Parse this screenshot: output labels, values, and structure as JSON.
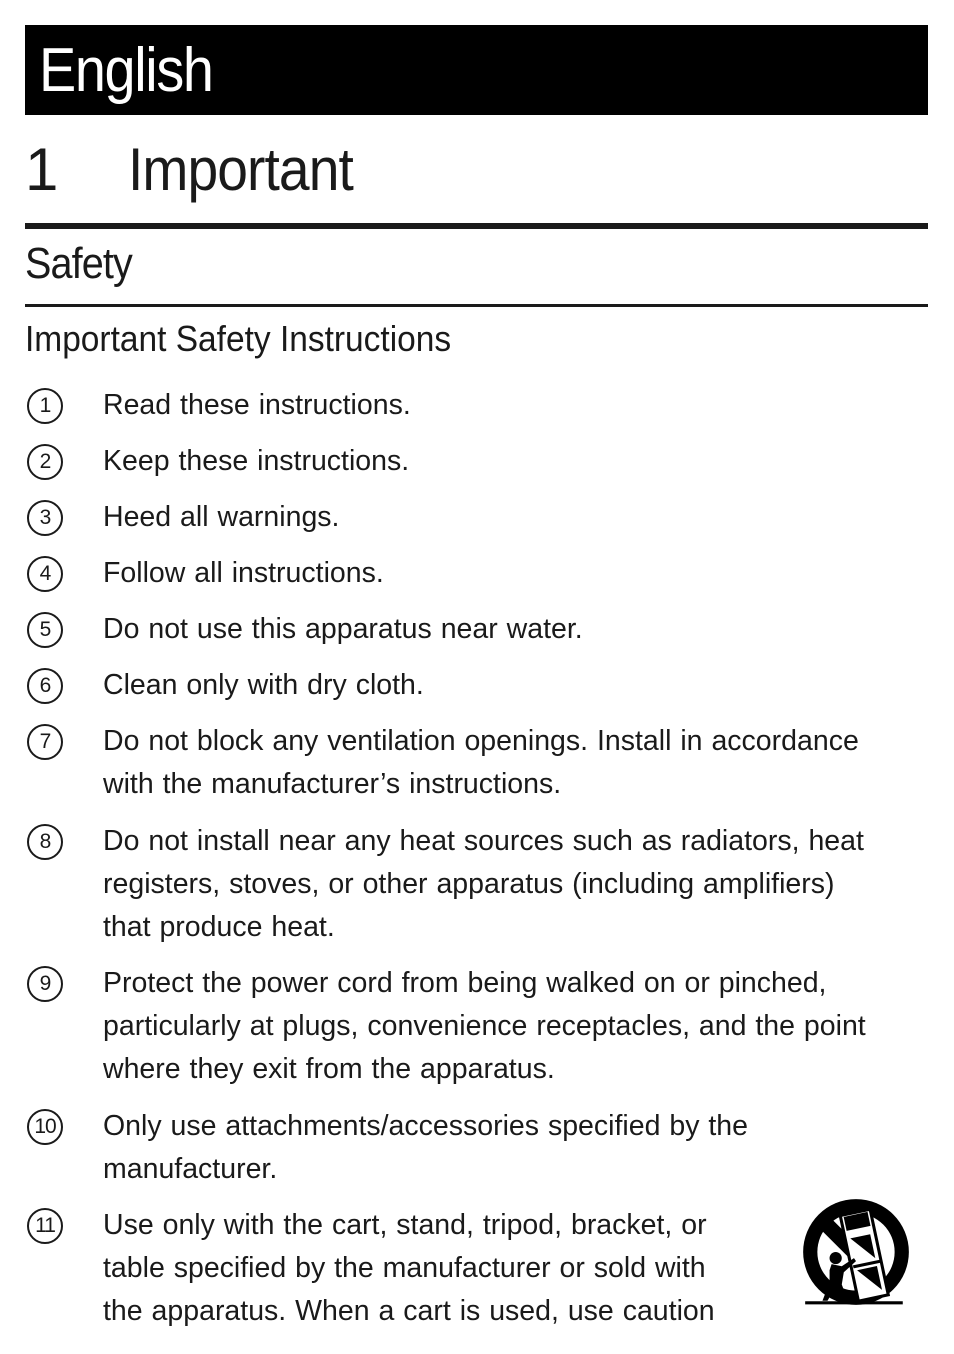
{
  "header": {
    "language": "English",
    "chapter_number": "1",
    "chapter_title": "Important",
    "section_title": "Safety",
    "subsection_title": "Important Safety Instructions"
  },
  "instructions": [
    {
      "number": "1",
      "text": "Read these instructions."
    },
    {
      "number": "2",
      "text": "Keep these instructions."
    },
    {
      "number": "3",
      "text": "Heed all warnings."
    },
    {
      "number": "4",
      "text": "Follow all instructions."
    },
    {
      "number": "5",
      "text": "Do not use this apparatus near water."
    },
    {
      "number": "6",
      "text": "Clean only with dry cloth."
    },
    {
      "number": "7",
      "text": "Do not block any ventilation openings. Install in accordance\nwith the manufacturer’s instructions."
    },
    {
      "number": "8",
      "text": "Do not install near any heat sources such as radiators, heat\nregisters, stoves, or other apparatus (including amplifiers)\nthat produce heat."
    },
    {
      "number": "9",
      "text": "Protect the power cord from being walked on or pinched,\nparticularly at plugs, convenience receptacles, and the point\nwhere they exit from the apparatus."
    },
    {
      "number": "10",
      "text": "Only use attachments/accessories specified by the\nmanufacturer."
    },
    {
      "number": "11",
      "text": "Use only with the cart, stand, tripod, bracket, or\ntable specified by the manufacturer or sold with\nthe apparatus. When a cart is used, use caution"
    }
  ],
  "icons": {
    "cart_warning": "cart-tip-over-warning-icon"
  }
}
